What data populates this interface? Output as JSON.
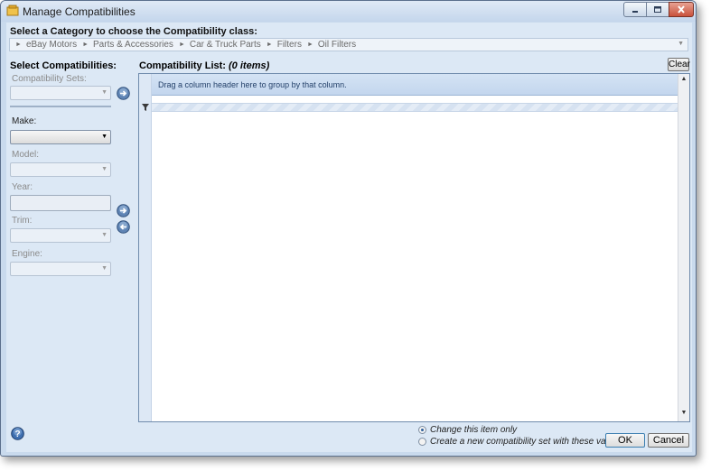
{
  "window": {
    "title": "Manage Compatibilities"
  },
  "category": {
    "label": "Select a Category to choose the Compatibility class:",
    "breadcrumb": [
      "eBay Motors",
      "Parts & Accessories",
      "Car & Truck Parts",
      "Filters",
      "Oil Filters"
    ]
  },
  "left_panel": {
    "title": "Select Compatibilities:",
    "compatibility_sets_label": "Compatibility Sets:",
    "make_label": "Make:",
    "model_label": "Model:",
    "year_label": "Year:",
    "trim_label": "Trim:",
    "engine_label": "Engine:"
  },
  "list": {
    "title_prefix": "Compatibility List:",
    "count": "(0 items)",
    "clear_label": "Clear",
    "group_hint": "Drag a column header here to group by that column."
  },
  "footer": {
    "option_change_item": "Change this item only",
    "option_create_set": "Create a new compatibility set with these values",
    "selected_option": "Change this item only",
    "ok_label": "OK",
    "cancel_label": "Cancel"
  },
  "icons": {
    "app": "app-icon",
    "help": "help-icon",
    "filter": "filter-icon",
    "arrow_right": "arrow-right-icon",
    "arrow_left": "arrow-left-icon"
  },
  "colors": {
    "window_bg": "#dce8f5",
    "group_panel": "#c3d6ee",
    "accent": "#2d5f9c"
  }
}
